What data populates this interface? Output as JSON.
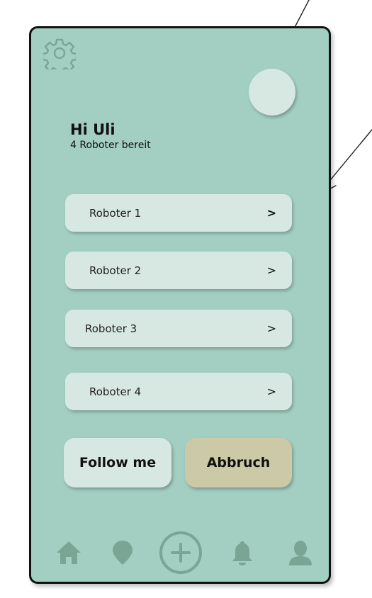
{
  "greeting": {
    "title": "Hi Uli",
    "subtitle": "4 Roboter bereit"
  },
  "robots": [
    {
      "label": "Roboter 1",
      "chevron": ">"
    },
    {
      "label": "Roboter 2",
      "chevron": ">"
    },
    {
      "label": "Roboter 3",
      "chevron": ">"
    },
    {
      "label": "Roboter 4",
      "chevron": ">"
    }
  ],
  "actions": {
    "follow_label": "Follow me",
    "abort_label": "Abbruch"
  },
  "nav": {
    "icons": [
      "home-icon",
      "location-pin-icon",
      "add-circle-icon",
      "bell-icon",
      "user-icon"
    ]
  },
  "colors": {
    "background": "#a3cfc2",
    "card": "#d7e8e2",
    "abort_button": "#ccc9a6",
    "nav_icon": "#7aa595"
  }
}
